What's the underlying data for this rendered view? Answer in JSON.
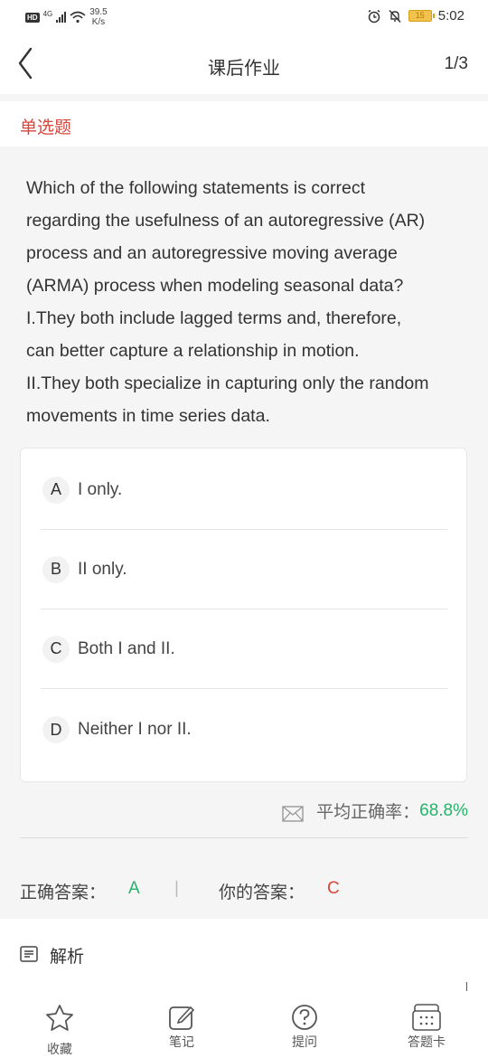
{
  "status_bar": {
    "network_badge": "HD",
    "signal_type": "4G",
    "speed_value": "39.5",
    "speed_unit": "K/s",
    "battery": "15",
    "time": "5:02"
  },
  "nav": {
    "title": "课后作业",
    "page_indicator": "1/3"
  },
  "question": {
    "type": "单选题",
    "lines": [
      "Which of the following statements is correct",
      "regarding the usefulness of an autoregressive (AR)",
      "process and an autoregressive moving average",
      "(ARMA) process when modeling seasonal data?",
      "I.They both include lagged terms and, therefore,",
      "can better capture a relationship in motion.",
      "II.They both specialize in capturing only the random",
      "movements in time series data."
    ]
  },
  "options": [
    {
      "letter": "A",
      "text": "I only."
    },
    {
      "letter": "B",
      "text": "II only."
    },
    {
      "letter": "C",
      "text": "Both I and II."
    },
    {
      "letter": "D",
      "text": "Neither I nor II."
    }
  ],
  "stats": {
    "accuracy_label": "平均正确率：",
    "accuracy_value": "68.8%"
  },
  "answers": {
    "correct_label": "正确答案：",
    "correct_value": "A",
    "separator": "|",
    "yours_label": "你的答案：",
    "yours_value": "C"
  },
  "analysis": {
    "label": "解析"
  },
  "tab_bar": [
    {
      "label": "收藏",
      "icon": "star-icon"
    },
    {
      "label": "笔记",
      "icon": "edit-note-icon"
    },
    {
      "label": "提问",
      "icon": "question-icon"
    },
    {
      "label": "答题卡",
      "icon": "answer-card-icon"
    }
  ],
  "colors": {
    "accent_red": "#d9453b",
    "accent_green": "#27b36b"
  }
}
